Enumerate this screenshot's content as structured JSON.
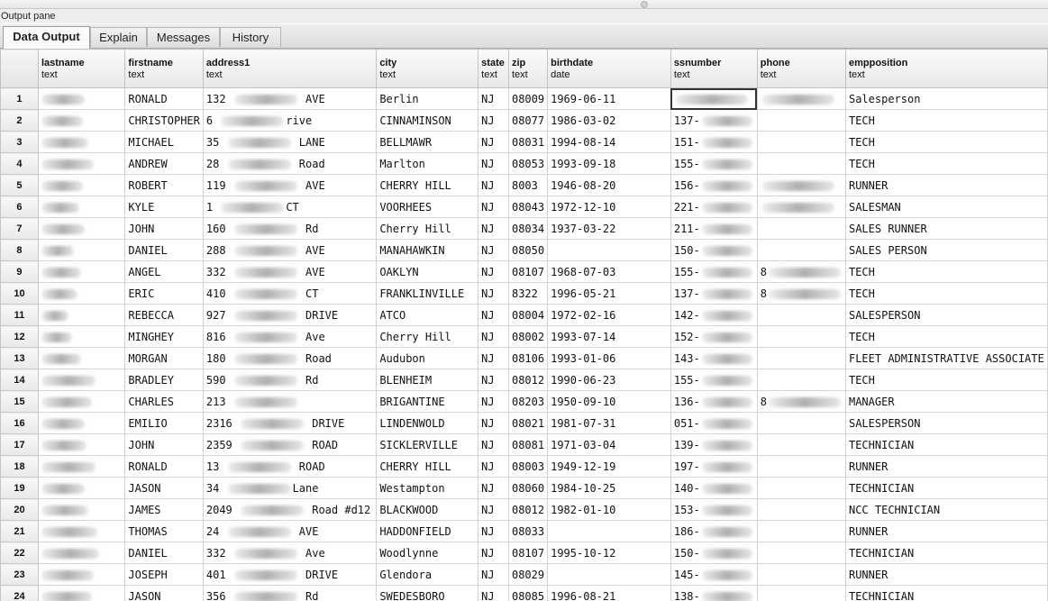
{
  "pane": {
    "title": "Output pane"
  },
  "tabs": [
    {
      "label": "Data Output",
      "active": true
    },
    {
      "label": "Explain",
      "active": false
    },
    {
      "label": "Messages",
      "active": false
    },
    {
      "label": "History",
      "active": false
    }
  ],
  "columns": [
    {
      "name": "lastname",
      "type": "text"
    },
    {
      "name": "firstname",
      "type": "text"
    },
    {
      "name": "address1",
      "type": "text"
    },
    {
      "name": "city",
      "type": "text"
    },
    {
      "name": "state",
      "type": "text"
    },
    {
      "name": "zip",
      "type": "text"
    },
    {
      "name": "birthdate",
      "type": "date"
    },
    {
      "name": "ssnumber",
      "type": "text"
    },
    {
      "name": "phone",
      "type": "text"
    },
    {
      "name": "empposition",
      "type": "text"
    }
  ],
  "rows": [
    {
      "n": "1",
      "lastname": "",
      "firstname": "RONALD",
      "address1": "132 [redacted] AVE",
      "city": "Berlin",
      "state": "NJ",
      "zip": "08009",
      "birthdate": "1969-06-11",
      "ssnumber": "[redacted]",
      "phone": "[redacted]",
      "empposition": "Salesperson"
    },
    {
      "n": "2",
      "lastname": "",
      "firstname": "CHRISTOPHER",
      "address1": "6 [redacted]rive",
      "city": "CINNAMINSON",
      "state": "NJ",
      "zip": "08077",
      "birthdate": "1986-03-02",
      "ssnumber": "137-[redacted]",
      "phone": "",
      "empposition": "TECH"
    },
    {
      "n": "3",
      "lastname": "",
      "firstname": "MICHAEL",
      "address1": "35 [redacted] LANE",
      "city": "BELLMAWR",
      "state": "NJ",
      "zip": "08031",
      "birthdate": "1994-08-14",
      "ssnumber": "151-[redacted]",
      "phone": "",
      "empposition": "TECH"
    },
    {
      "n": "4",
      "lastname": "",
      "firstname": "ANDREW",
      "address1": "28 [redacted] Road",
      "city": "Marlton",
      "state": "NJ",
      "zip": "08053",
      "birthdate": "1993-09-18",
      "ssnumber": "155-[redacted]",
      "phone": "",
      "empposition": "TECH"
    },
    {
      "n": "5",
      "lastname": "",
      "firstname": "ROBERT",
      "address1": "119 [redacted] AVE",
      "city": "CHERRY HILL",
      "state": "NJ",
      "zip": "8003",
      "birthdate": "1946-08-20",
      "ssnumber": "156-[redacted]",
      "phone": "[redacted]",
      "empposition": "RUNNER"
    },
    {
      "n": "6",
      "lastname": "",
      "firstname": "KYLE",
      "address1": "1 [redacted]CT",
      "city": "VOORHEES",
      "state": "NJ",
      "zip": "08043",
      "birthdate": "1972-12-10",
      "ssnumber": "221-[redacted]",
      "phone": "[redacted]",
      "empposition": "SALESMAN"
    },
    {
      "n": "7",
      "lastname": "",
      "firstname": "JOHN",
      "address1": "160 [redacted] Rd",
      "city": "Cherry Hill",
      "state": "NJ",
      "zip": "08034",
      "birthdate": "1937-03-22",
      "ssnumber": "211-[redacted]",
      "phone": "",
      "empposition": "SALES RUNNER"
    },
    {
      "n": "8",
      "lastname": "",
      "firstname": "DANIEL",
      "address1": "288 [redacted] AVE",
      "city": "MANAHAWKIN",
      "state": "NJ",
      "zip": "08050",
      "birthdate": "",
      "ssnumber": "150-[redacted]",
      "phone": "",
      "empposition": "SALES PERSON"
    },
    {
      "n": "9",
      "lastname": "",
      "firstname": "ANGEL",
      "address1": "332 [redacted] AVE",
      "city": "OAKLYN",
      "state": "NJ",
      "zip": "08107",
      "birthdate": "1968-07-03",
      "ssnumber": "155-[redacted]",
      "phone": "8[redacted]",
      "empposition": "TECH"
    },
    {
      "n": "10",
      "lastname": "",
      "firstname": "ERIC",
      "address1": "410 [redacted] CT",
      "city": "FRANKLINVILLE",
      "state": "NJ",
      "zip": "8322",
      "birthdate": "1996-05-21",
      "ssnumber": "137-[redacted]",
      "phone": "8[redacted]",
      "empposition": "TECH"
    },
    {
      "n": "11",
      "lastname": "",
      "firstname": "REBECCA",
      "address1": "927 [redacted] DRIVE",
      "city": "ATCO",
      "state": "NJ",
      "zip": "08004",
      "birthdate": "1972-02-16",
      "ssnumber": "142-[redacted]",
      "phone": "",
      "empposition": "SALESPERSON"
    },
    {
      "n": "12",
      "lastname": "",
      "firstname": "MINGHEY",
      "address1": "816 [redacted] Ave",
      "city": "Cherry Hill",
      "state": "NJ",
      "zip": "08002",
      "birthdate": "1993-07-14",
      "ssnumber": "152-[redacted]",
      "phone": "",
      "empposition": "TECH"
    },
    {
      "n": "13",
      "lastname": "",
      "firstname": "MORGAN",
      "address1": "180 [redacted] Road",
      "city": "Audubon",
      "state": "NJ",
      "zip": "08106",
      "birthdate": "1993-01-06",
      "ssnumber": "143-[redacted]",
      "phone": "",
      "empposition": "FLEET ADMINISTRATIVE ASSOCIATE"
    },
    {
      "n": "14",
      "lastname": "",
      "firstname": "BRADLEY",
      "address1": "590 [redacted] Rd",
      "city": "BLENHEIM",
      "state": "NJ",
      "zip": "08012",
      "birthdate": "1990-06-23",
      "ssnumber": "155-[redacted]",
      "phone": "",
      "empposition": "TECH"
    },
    {
      "n": "15",
      "lastname": "",
      "firstname": "CHARLES",
      "address1": "213 [redacted]",
      "city": "BRIGANTINE",
      "state": "NJ",
      "zip": "08203",
      "birthdate": "1950-09-10",
      "ssnumber": "136-[redacted]",
      "phone": "8[redacted]",
      "empposition": "MANAGER"
    },
    {
      "n": "16",
      "lastname": "",
      "firstname": "EMILIO",
      "address1": "2316 [redacted] DRIVE",
      "city": "LINDENWOLD",
      "state": "NJ",
      "zip": "08021",
      "birthdate": "1981-07-31",
      "ssnumber": "051-[redacted]",
      "phone": "",
      "empposition": "SALESPERSON"
    },
    {
      "n": "17",
      "lastname": "",
      "firstname": "JOHN",
      "address1": "2359 [redacted] ROAD",
      "city": "SICKLERVILLE",
      "state": "NJ",
      "zip": "08081",
      "birthdate": "1971-03-04",
      "ssnumber": "139-[redacted]",
      "phone": "",
      "empposition": "TECHNICIAN"
    },
    {
      "n": "18",
      "lastname": "",
      "firstname": "RONALD",
      "address1": "13 [redacted] ROAD",
      "city": "CHERRY HILL",
      "state": "NJ",
      "zip": "08003",
      "birthdate": "1949-12-19",
      "ssnumber": "197-[redacted]",
      "phone": "",
      "empposition": "RUNNER"
    },
    {
      "n": "19",
      "lastname": "",
      "firstname": "JASON",
      "address1": "34 [redacted]Lane",
      "city": "Westampton",
      "state": "NJ",
      "zip": "08060",
      "birthdate": "1984-10-25",
      "ssnumber": "140-[redacted]",
      "phone": "",
      "empposition": "TECHNICIAN"
    },
    {
      "n": "20",
      "lastname": "",
      "firstname": "JAMES",
      "address1": "2049 [redacted] Road #d12",
      "city": "BLACKWOOD",
      "state": "NJ",
      "zip": "08012",
      "birthdate": "1982-01-10",
      "ssnumber": "153-[redacted]",
      "phone": "",
      "empposition": "NCC TECHNICIAN"
    },
    {
      "n": "21",
      "lastname": "",
      "firstname": "THOMAS",
      "address1": "24 [redacted] AVE",
      "city": "HADDONFIELD",
      "state": "NJ",
      "zip": "08033",
      "birthdate": "",
      "ssnumber": "186-[redacted]",
      "phone": "",
      "empposition": "RUNNER"
    },
    {
      "n": "22",
      "lastname": "",
      "firstname": "DANIEL",
      "address1": "332 [redacted] Ave",
      "city": "Woodlynne",
      "state": "NJ",
      "zip": "08107",
      "birthdate": "1995-10-12",
      "ssnumber": "150-[redacted]",
      "phone": "",
      "empposition": "TECHNICIAN"
    },
    {
      "n": "23",
      "lastname": "",
      "firstname": "JOSEPH",
      "address1": "401 [redacted] DRIVE",
      "city": "Glendora",
      "state": "NJ",
      "zip": "08029",
      "birthdate": "",
      "ssnumber": "145-[redacted]",
      "phone": "",
      "empposition": "RUNNER"
    },
    {
      "n": "24",
      "lastname": "",
      "firstname": "JASON",
      "address1": "356 [redacted] Rd",
      "city": "SWEDESBORO",
      "state": "NJ",
      "zip": "08085",
      "birthdate": "1996-08-21",
      "ssnumber": "138-[redacted]",
      "phone": "",
      "empposition": "TECHNICIAN"
    }
  ]
}
